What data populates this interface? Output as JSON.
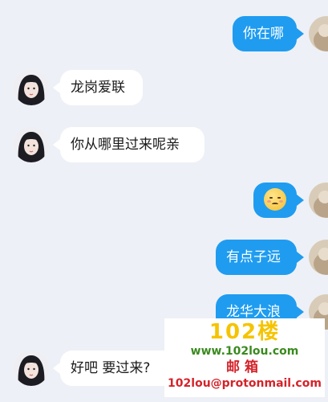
{
  "messages": [
    {
      "side": "out",
      "text": "你在哪"
    },
    {
      "side": "in",
      "text": "龙岗爱联"
    },
    {
      "side": "in",
      "text": "你从哪里过来呢亲"
    },
    {
      "side": "out",
      "emoji": "smiling-face-emoji"
    },
    {
      "side": "out",
      "text": "有点子远"
    },
    {
      "side": "out",
      "text": "龙华大浪"
    },
    {
      "side": "in",
      "text": "好吧 要过来?"
    }
  ],
  "watermark": {
    "brand": "102楼",
    "site": "www.102lou.com",
    "mail_label": "邮箱",
    "email": "102lou@protonmail.com"
  },
  "colors": {
    "background": "#eef0f7",
    "incoming_bubble": "#ffffff",
    "outgoing_bubble": "#1f9cf0"
  }
}
